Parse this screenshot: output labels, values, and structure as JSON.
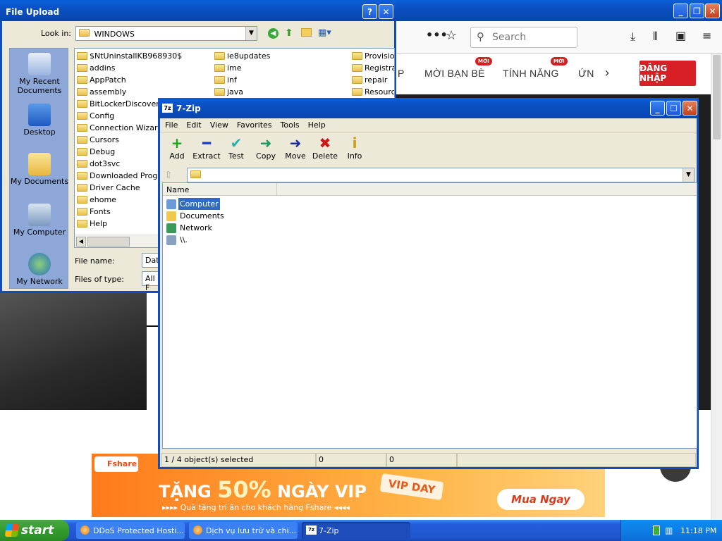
{
  "browser": {
    "search_placeholder": "Search",
    "nav": [
      {
        "label": "P"
      },
      {
        "label": "MỜI BẠN BÈ",
        "badge": "MỚI"
      },
      {
        "label": "TÍNH NĂNG",
        "badge": "MỚI"
      },
      {
        "label": "ỨN"
      }
    ],
    "login_label": "ĐĂNG NHẬP",
    "banner": {
      "brand": "Fshare",
      "headline_prefix": "TẶNG",
      "headline_percent": "50%",
      "headline_suffix": "NGÀY VIP",
      "subline": "▸▸▸▸ Quà tặng tri ân cho khách hàng Fshare ◂◂◂◂",
      "tag": "VIP DAY",
      "cta": "Mua Ngay"
    }
  },
  "upload_dialog": {
    "title": "File Upload",
    "help_btn": "?",
    "close_btn": "✕",
    "look_in_label": "Look in:",
    "look_in_value": "WINDOWS",
    "places": [
      "My Recent Documents",
      "Desktop",
      "My Documents",
      "My Computer",
      "My Network"
    ],
    "col1": [
      "$NtUninstallKB968930$",
      "addins",
      "AppPatch",
      "assembly",
      "BitLockerDiscoveryVo",
      "Config",
      "Connection Wizard",
      "Cursors",
      "Debug",
      "dot3svc",
      "Downloaded Program",
      "Driver Cache",
      "ehome",
      "Fonts",
      "Help"
    ],
    "col2": [
      "ie8updates",
      "ime",
      "inf",
      "java"
    ],
    "col3": [
      "Provisio",
      "Registra",
      "repair",
      "Resourc"
    ],
    "file_name_label": "File name:",
    "file_name_value": "Data",
    "file_type_label": "Files of type:",
    "file_type_value": "All F"
  },
  "zip": {
    "title": "7-Zip",
    "title_icon": "7z",
    "menu": [
      "File",
      "Edit",
      "View",
      "Favorites",
      "Tools",
      "Help"
    ],
    "toolbar": [
      {
        "label": "Add",
        "icon": "+",
        "color": "#1aa51a"
      },
      {
        "label": "Extract",
        "icon": "━",
        "color": "#1c3cc8"
      },
      {
        "label": "Test",
        "icon": "✔",
        "color": "#22b0b0"
      },
      {
        "label": "Copy",
        "icon": "➜",
        "color": "#1a9a60"
      },
      {
        "label": "Move",
        "icon": "➜",
        "color": "#1a2aa0"
      },
      {
        "label": "Delete",
        "icon": "✖",
        "color": "#d01818"
      },
      {
        "label": "Info",
        "icon": "i",
        "color": "#c8a010"
      }
    ],
    "column_name": "Name",
    "items": [
      "Computer",
      "Documents",
      "Network",
      "\\\\."
    ],
    "selected_index": 0,
    "status": {
      "selection": "1 / 4 object(s) selected",
      "size": "0",
      "packed": "0"
    }
  },
  "taskbar": {
    "start_label": "start",
    "tasks": [
      {
        "label": "DDoS Protected Hosti..."
      },
      {
        "label": "Dịch vụ lưu trữ và chi..."
      },
      {
        "label": "7-Zip",
        "active": true
      }
    ],
    "clock": "11:18 PM"
  },
  "colors": {
    "xp_blue": "#0b4fc0",
    "accent_red": "#d81f26",
    "selection": "#316ac5"
  }
}
